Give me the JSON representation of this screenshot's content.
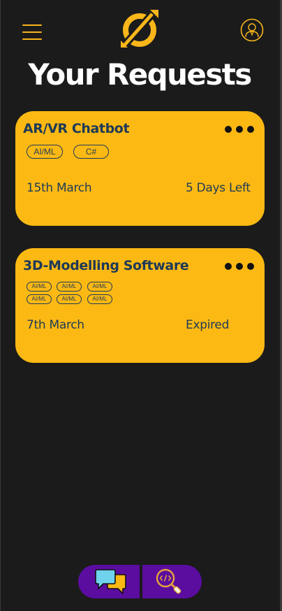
{
  "header": {
    "menu_icon": "hamburger-menu-icon",
    "logo_icon": "app-logo-icon",
    "profile_icon": "user-profile-icon",
    "title": "Your Requests"
  },
  "colors": {
    "background": "#1b1b1b",
    "accent": "#fdb913",
    "card_text": "#1d3a57",
    "nav": "#5b0da0"
  },
  "requests": [
    {
      "title": "AR/VR Chatbot",
      "tags": [
        "AI/ML",
        "C#"
      ],
      "date": "15th March",
      "status": "5 Days Left"
    },
    {
      "title": "3D-Modelling Software",
      "tags": [
        "AI/ML",
        "AI/ML",
        "AI/ML",
        "AI/ML",
        "AI/ML",
        "AI/ML"
      ],
      "date": "7th March",
      "status": "Expired"
    }
  ],
  "bottom_nav": {
    "items": [
      {
        "icon": "chat-bubbles-icon"
      },
      {
        "icon": "code-search-icon"
      }
    ]
  }
}
